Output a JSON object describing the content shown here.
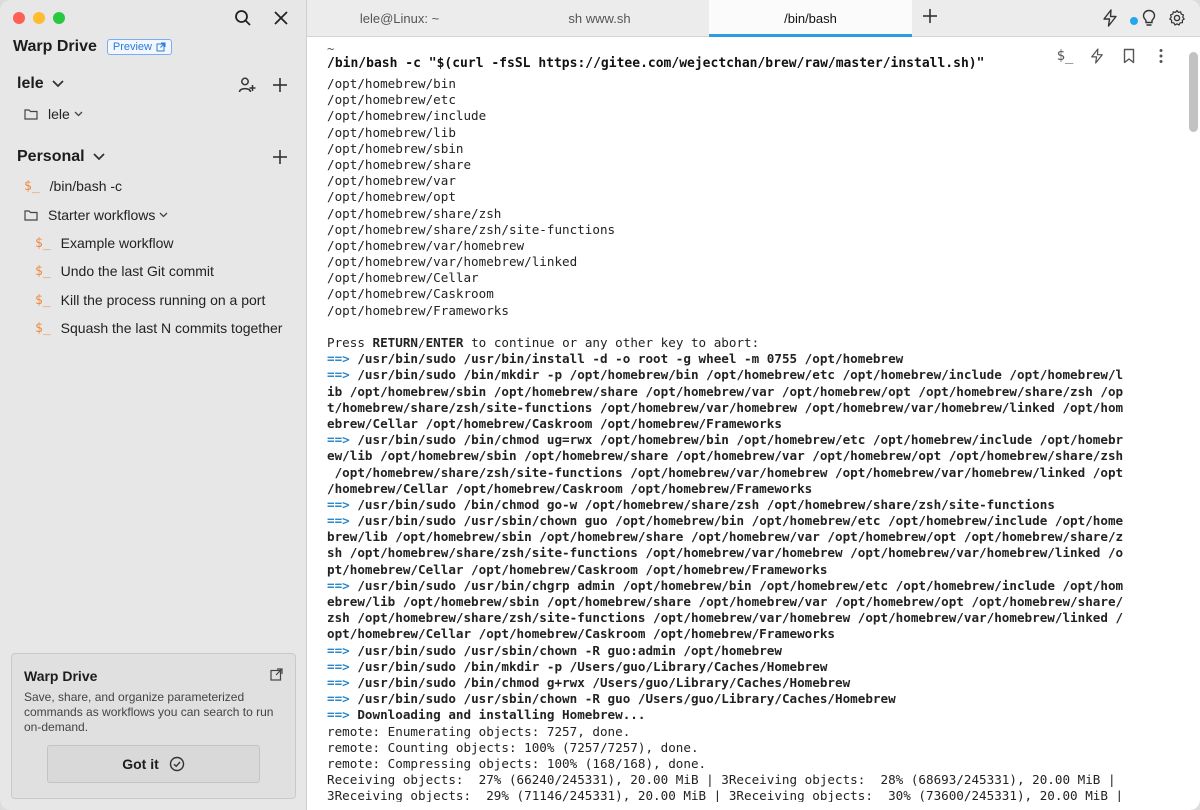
{
  "sidebar": {
    "title": "Warp Drive",
    "preview_label": "Preview",
    "team": {
      "name": "lele",
      "folder": "lele"
    },
    "personal": {
      "name": "Personal",
      "items": [
        {
          "label": "/bin/bash -c"
        }
      ],
      "folder": "Starter workflows",
      "workflows": [
        {
          "label": "Example workflow"
        },
        {
          "label": "Undo the last Git commit"
        },
        {
          "label": "Kill the process running on a port"
        },
        {
          "label": "Squash the last N commits together"
        }
      ]
    },
    "info_card": {
      "title": "Warp Drive",
      "description": "Save, share, and organize parameterized commands as workflows you can search to run on-demand.",
      "button": "Got it"
    }
  },
  "tabs": [
    {
      "label": "lele@Linux: ~"
    },
    {
      "label": "sh www.sh"
    },
    {
      "label": "/bin/bash"
    }
  ],
  "block": {
    "dir": "~",
    "command": "/bin/bash -c \"$(curl -fsSL https://gitee.com/wejectchan/brew/raw/master/install.sh)\""
  },
  "terminal": {
    "lines": [
      {
        "text": "/opt/homebrew/bin"
      },
      {
        "text": "/opt/homebrew/etc"
      },
      {
        "text": "/opt/homebrew/include"
      },
      {
        "text": "/opt/homebrew/lib"
      },
      {
        "text": "/opt/homebrew/sbin"
      },
      {
        "text": "/opt/homebrew/share"
      },
      {
        "text": "/opt/homebrew/var"
      },
      {
        "text": "/opt/homebrew/opt"
      },
      {
        "text": "/opt/homebrew/share/zsh"
      },
      {
        "text": "/opt/homebrew/share/zsh/site-functions"
      },
      {
        "text": "/opt/homebrew/var/homebrew"
      },
      {
        "text": "/opt/homebrew/var/homebrew/linked"
      },
      {
        "text": "/opt/homebrew/Cellar"
      },
      {
        "text": "/opt/homebrew/Caskroom"
      },
      {
        "text": "/opt/homebrew/Frameworks"
      },
      {
        "text": ""
      },
      {
        "type": "press",
        "pre": "Press ",
        "b1": "RETURN",
        "sep": "/",
        "b2": "ENTER",
        "post": " to continue or any other key to abort:"
      },
      {
        "type": "cmd",
        "text": "/usr/bin/sudo /usr/bin/install -d -o root -g wheel -m 0755 /opt/homebrew"
      },
      {
        "type": "cmd",
        "text": "/usr/bin/sudo /bin/mkdir -p /opt/homebrew/bin /opt/homebrew/etc /opt/homebrew/include /opt/homebrew/l"
      },
      {
        "type": "bold",
        "text": "ib /opt/homebrew/sbin /opt/homebrew/share /opt/homebrew/var /opt/homebrew/opt /opt/homebrew/share/zsh /op"
      },
      {
        "type": "bold",
        "text": "t/homebrew/share/zsh/site-functions /opt/homebrew/var/homebrew /opt/homebrew/var/homebrew/linked /opt/hom"
      },
      {
        "type": "bold",
        "text": "ebrew/Cellar /opt/homebrew/Caskroom /opt/homebrew/Frameworks"
      },
      {
        "type": "cmd",
        "text": "/usr/bin/sudo /bin/chmod ug=rwx /opt/homebrew/bin /opt/homebrew/etc /opt/homebrew/include /opt/homebr"
      },
      {
        "type": "bold",
        "text": "ew/lib /opt/homebrew/sbin /opt/homebrew/share /opt/homebrew/var /opt/homebrew/opt /opt/homebrew/share/zsh"
      },
      {
        "type": "bold",
        "text": " /opt/homebrew/share/zsh/site-functions /opt/homebrew/var/homebrew /opt/homebrew/var/homebrew/linked /opt"
      },
      {
        "type": "bold",
        "text": "/homebrew/Cellar /opt/homebrew/Caskroom /opt/homebrew/Frameworks"
      },
      {
        "type": "cmd",
        "text": "/usr/bin/sudo /bin/chmod go-w /opt/homebrew/share/zsh /opt/homebrew/share/zsh/site-functions"
      },
      {
        "type": "cmd",
        "text": "/usr/bin/sudo /usr/sbin/chown guo /opt/homebrew/bin /opt/homebrew/etc /opt/homebrew/include /opt/home"
      },
      {
        "type": "bold",
        "text": "brew/lib /opt/homebrew/sbin /opt/homebrew/share /opt/homebrew/var /opt/homebrew/opt /opt/homebrew/share/z"
      },
      {
        "type": "bold",
        "text": "sh /opt/homebrew/share/zsh/site-functions /opt/homebrew/var/homebrew /opt/homebrew/var/homebrew/linked /o"
      },
      {
        "type": "bold",
        "text": "pt/homebrew/Cellar /opt/homebrew/Caskroom /opt/homebrew/Frameworks"
      },
      {
        "type": "cmd",
        "text": "/usr/bin/sudo /usr/bin/chgrp admin /opt/homebrew/bin /opt/homebrew/etc /opt/homebrew/include /opt/hom"
      },
      {
        "type": "bold",
        "text": "ebrew/lib /opt/homebrew/sbin /opt/homebrew/share /opt/homebrew/var /opt/homebrew/opt /opt/homebrew/share/"
      },
      {
        "type": "bold",
        "text": "zsh /opt/homebrew/share/zsh/site-functions /opt/homebrew/var/homebrew /opt/homebrew/var/homebrew/linked /"
      },
      {
        "type": "bold",
        "text": "opt/homebrew/Cellar /opt/homebrew/Caskroom /opt/homebrew/Frameworks"
      },
      {
        "type": "cmd",
        "text": "/usr/bin/sudo /usr/sbin/chown -R guo:admin /opt/homebrew"
      },
      {
        "type": "cmd",
        "text": "/usr/bin/sudo /bin/mkdir -p /Users/guo/Library/Caches/Homebrew"
      },
      {
        "type": "cmd",
        "text": "/usr/bin/sudo /bin/chmod g+rwx /Users/guo/Library/Caches/Homebrew"
      },
      {
        "type": "cmd",
        "text": "/usr/bin/sudo /usr/sbin/chown -R guo /Users/guo/Library/Caches/Homebrew"
      },
      {
        "type": "cmd",
        "text": "Downloading and installing Homebrew..."
      },
      {
        "text": "remote: Enumerating objects: 7257, done."
      },
      {
        "text": "remote: Counting objects: 100% (7257/7257), done."
      },
      {
        "text": "remote: Compressing objects: 100% (168/168), done."
      },
      {
        "text": "Receiving objects:  27% (66240/245331), 20.00 MiB | 3Receiving objects:  28% (68693/245331), 20.00 MiB |"
      },
      {
        "text": "3Receiving objects:  29% (71146/245331), 20.00 MiB | 3Receiving objects:  30% (73600/245331), 20.00 MiB |"
      }
    ],
    "arrow": "==>"
  },
  "colors": {
    "accent": "#2d9de0",
    "workflow_icon": "#f0883e",
    "prompt_arrow": "#2a87c9"
  }
}
